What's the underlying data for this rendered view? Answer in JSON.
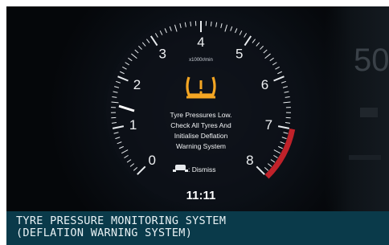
{
  "gauge": {
    "ticks": [
      "0",
      "1",
      "2",
      "3",
      "4",
      "5",
      "6",
      "7",
      "8"
    ],
    "unit": "x1000r/min"
  },
  "warning": {
    "icon": "tpms-warning-icon",
    "icon_color": "#f5a623",
    "lines": [
      "Tyre Pressures Low.",
      "Check All Tyres And",
      "Initialise Deflation",
      "Warning System"
    ],
    "dismiss_label": ": Dismiss"
  },
  "clock": "11:11",
  "right_display": {
    "speed": "50"
  },
  "caption": {
    "line1": "TYRE PRESSURE MONITORING SYSTEM",
    "line2": "(DEFLATION WARNING SYSTEM)"
  },
  "colors": {
    "redline": "#c0222a",
    "caption_bg": "#0a3a4a",
    "needle": "#ffffff"
  }
}
